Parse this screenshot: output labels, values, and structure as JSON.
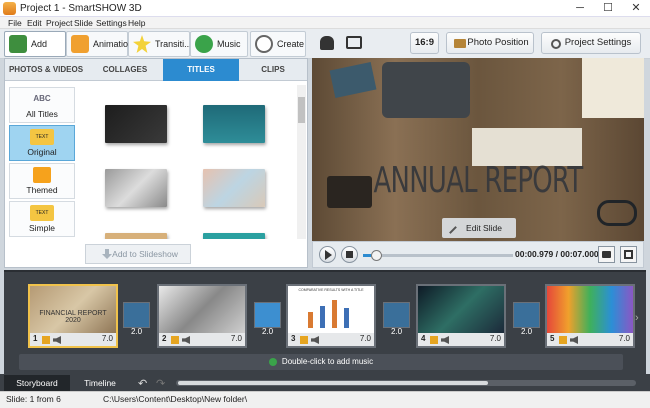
{
  "window": {
    "title": "Project 1 - SmartSHOW 3D",
    "minimize": "─",
    "maximize": "☐",
    "close": "✕"
  },
  "menu": [
    "File",
    "Edit",
    "Project",
    "Slide",
    "Settings",
    "Help"
  ],
  "toolbar": {
    "tabs": [
      "Add",
      "Animation",
      "Transiti...",
      "Music",
      "Create"
    ],
    "aspect": "16:9",
    "photo_position": "Photo Position",
    "project_settings": "Project Settings"
  },
  "library": {
    "subtabs": [
      "PHOTOS & VIDEOS",
      "COLLAGES",
      "TITLES",
      "CLIPS"
    ],
    "categories": [
      {
        "label": "All Titles",
        "icon_text": "ABC"
      },
      {
        "label": "Original",
        "icon_text": "TEXT"
      },
      {
        "label": "Themed",
        "icon_text": ""
      },
      {
        "label": "Simple",
        "icon_text": "TEXT"
      }
    ],
    "add_button": "Add to Slideshow"
  },
  "preview": {
    "headline": "ANNUAL REPORT",
    "edit_button": "Edit Slide"
  },
  "player": {
    "time": "00:00.979 / 00:07.000",
    "progress": 0.05
  },
  "storyboard": {
    "slides": [
      {
        "num": "1",
        "dur": "7.0",
        "caption": "FINANCIAL REPORT 2020"
      },
      {
        "num": "2",
        "dur": "7.0"
      },
      {
        "num": "3",
        "dur": "7.0",
        "chart_title": "COMPARATIVE RESULTS WITH A TITLE"
      },
      {
        "num": "4",
        "dur": "7.0"
      },
      {
        "num": "5",
        "dur": "7.0"
      }
    ],
    "transitions": [
      "2.0",
      "2.0",
      "2.0",
      "2.0"
    ],
    "music_hint": "Double-click to add music"
  },
  "bottom": {
    "tabs": [
      "Storyboard",
      "Timeline"
    ]
  },
  "status": {
    "slide": "Slide: 1 from 6",
    "path": "C:\\Users\\Content\\Desktop\\New folder\\"
  },
  "colors": {
    "accent": "#2c8bd0",
    "selection": "#f0c24b"
  }
}
